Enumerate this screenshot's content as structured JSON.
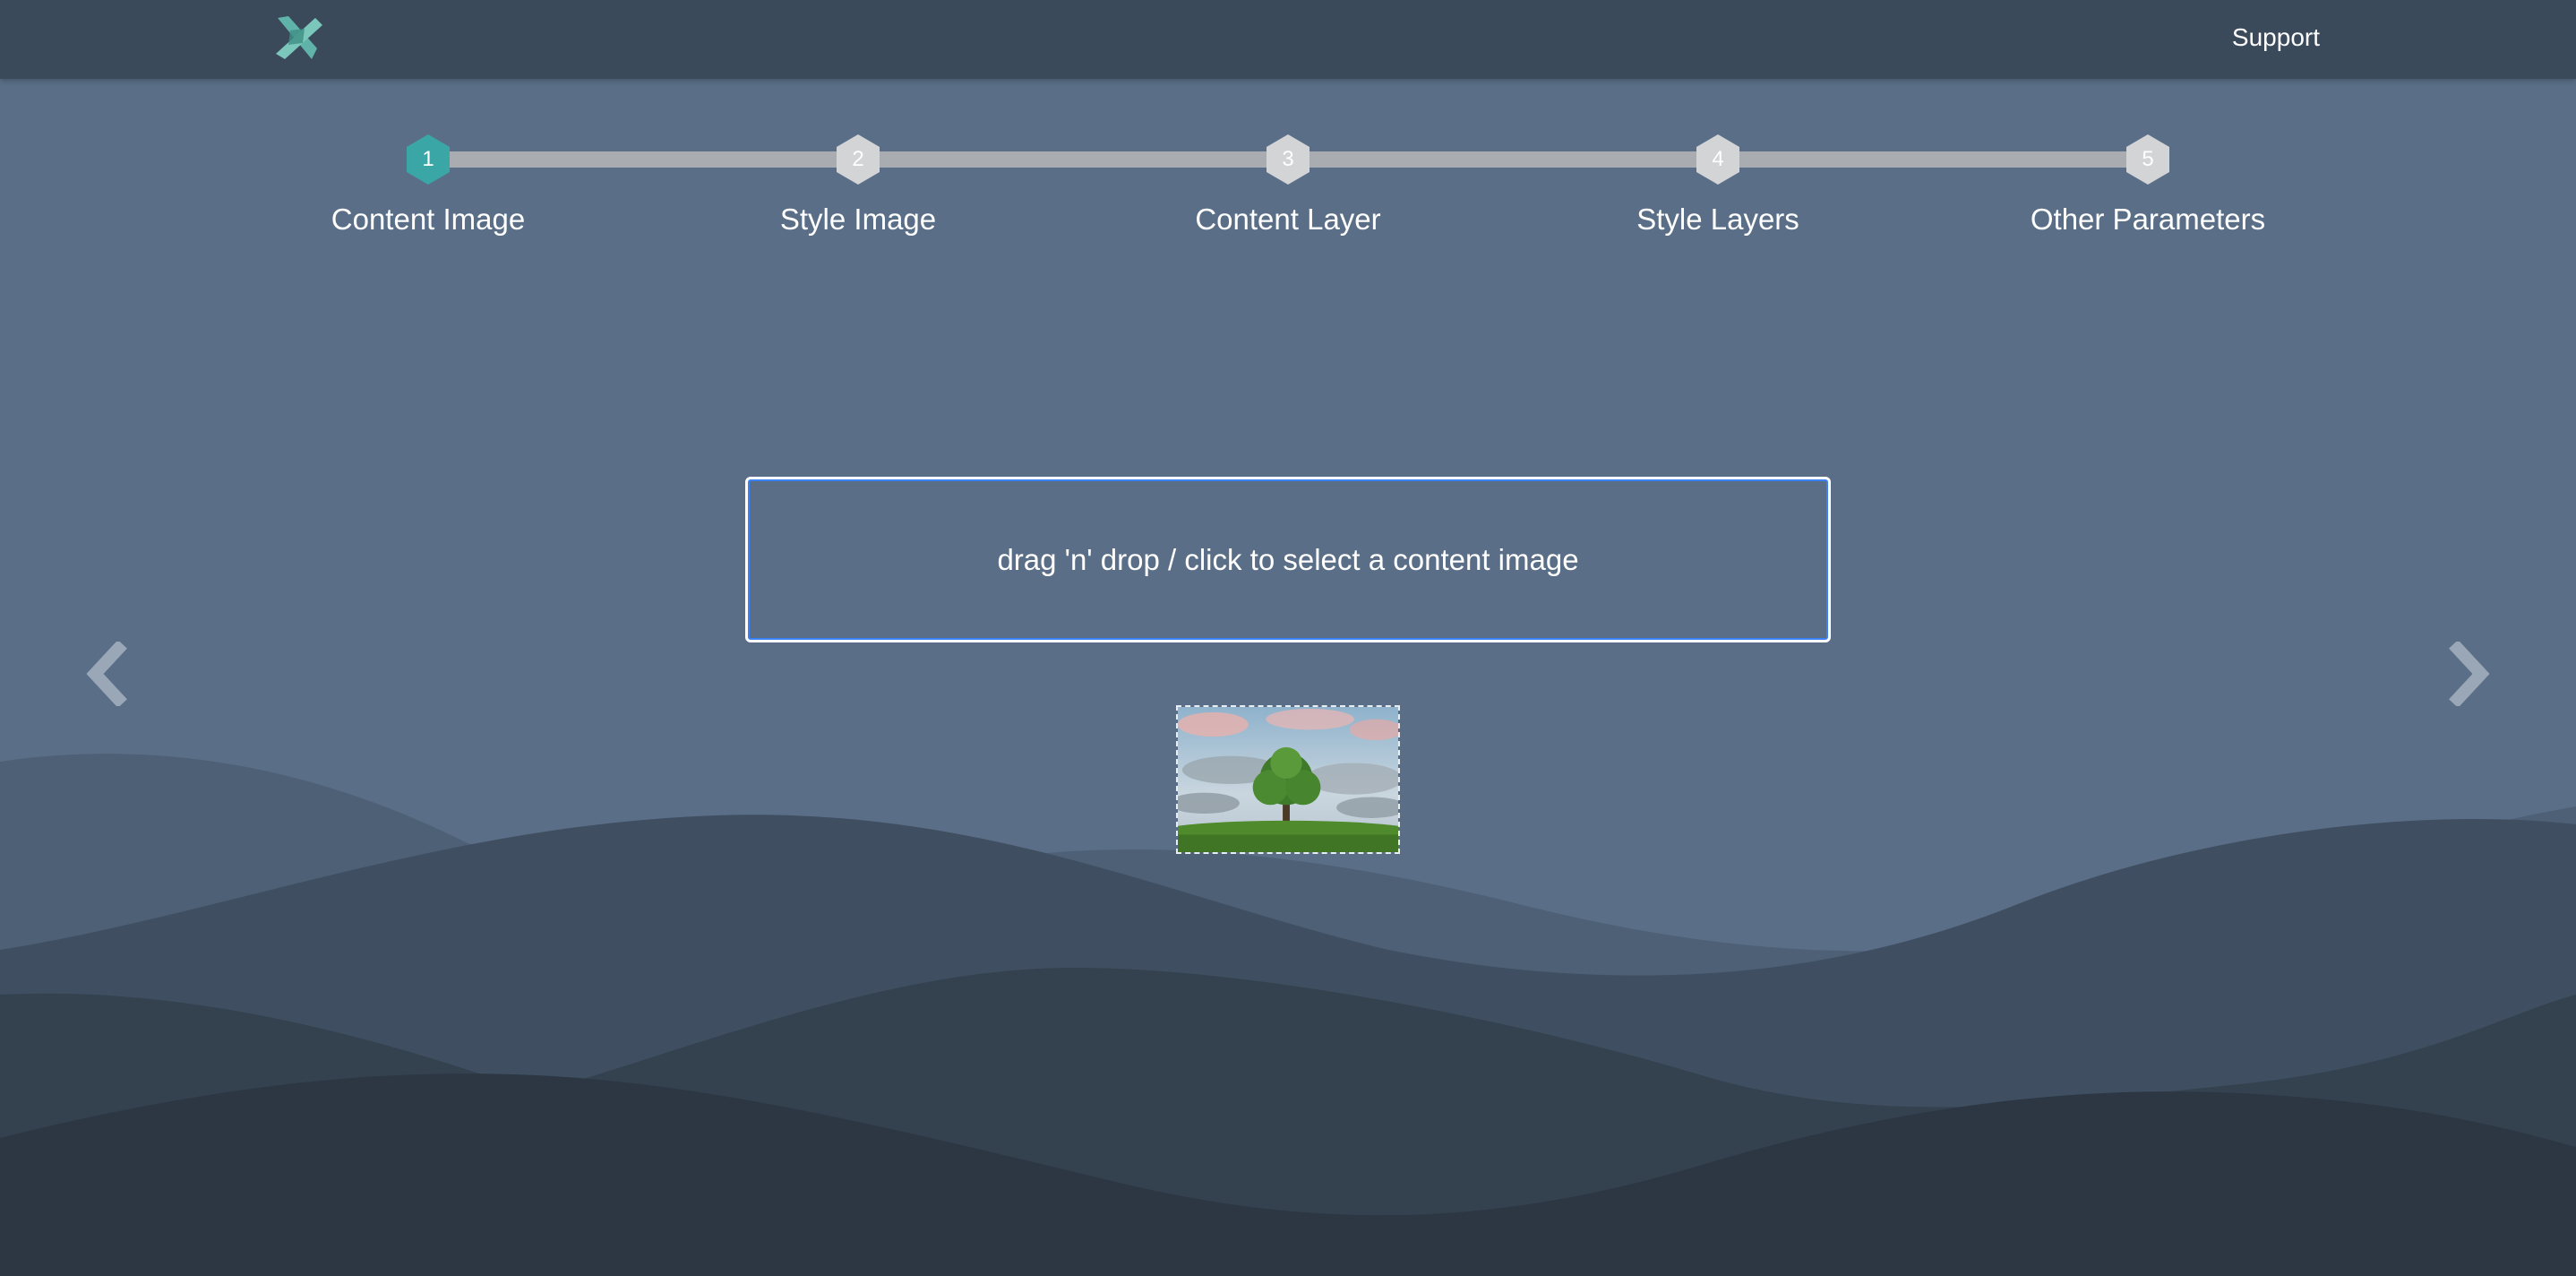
{
  "header": {
    "logo_icon": "app-logo-icon",
    "support_label": "Support"
  },
  "stepper": {
    "steps": [
      {
        "number": "1",
        "label": "Content Image",
        "active": true
      },
      {
        "number": "2",
        "label": "Style Image",
        "active": false
      },
      {
        "number": "3",
        "label": "Content Layer",
        "active": false
      },
      {
        "number": "4",
        "label": "Style Layers",
        "active": false
      },
      {
        "number": "5",
        "label": "Other Parameters",
        "active": false
      }
    ],
    "active_color": "#3aa6a6",
    "inactive_color": "#d3d4d6"
  },
  "dropzone": {
    "text": "drag 'n' drop / click to select a content image"
  },
  "thumbnail": {
    "icon": "tree-landscape-thumbnail"
  },
  "navigation": {
    "prev_icon": "chevron-left-icon",
    "next_icon": "chevron-right-icon"
  },
  "colors": {
    "background": "#5a6f87",
    "header": "#3b4a5b",
    "accent": "#3aa6a6",
    "dropzone_border": "#3b82f6"
  }
}
